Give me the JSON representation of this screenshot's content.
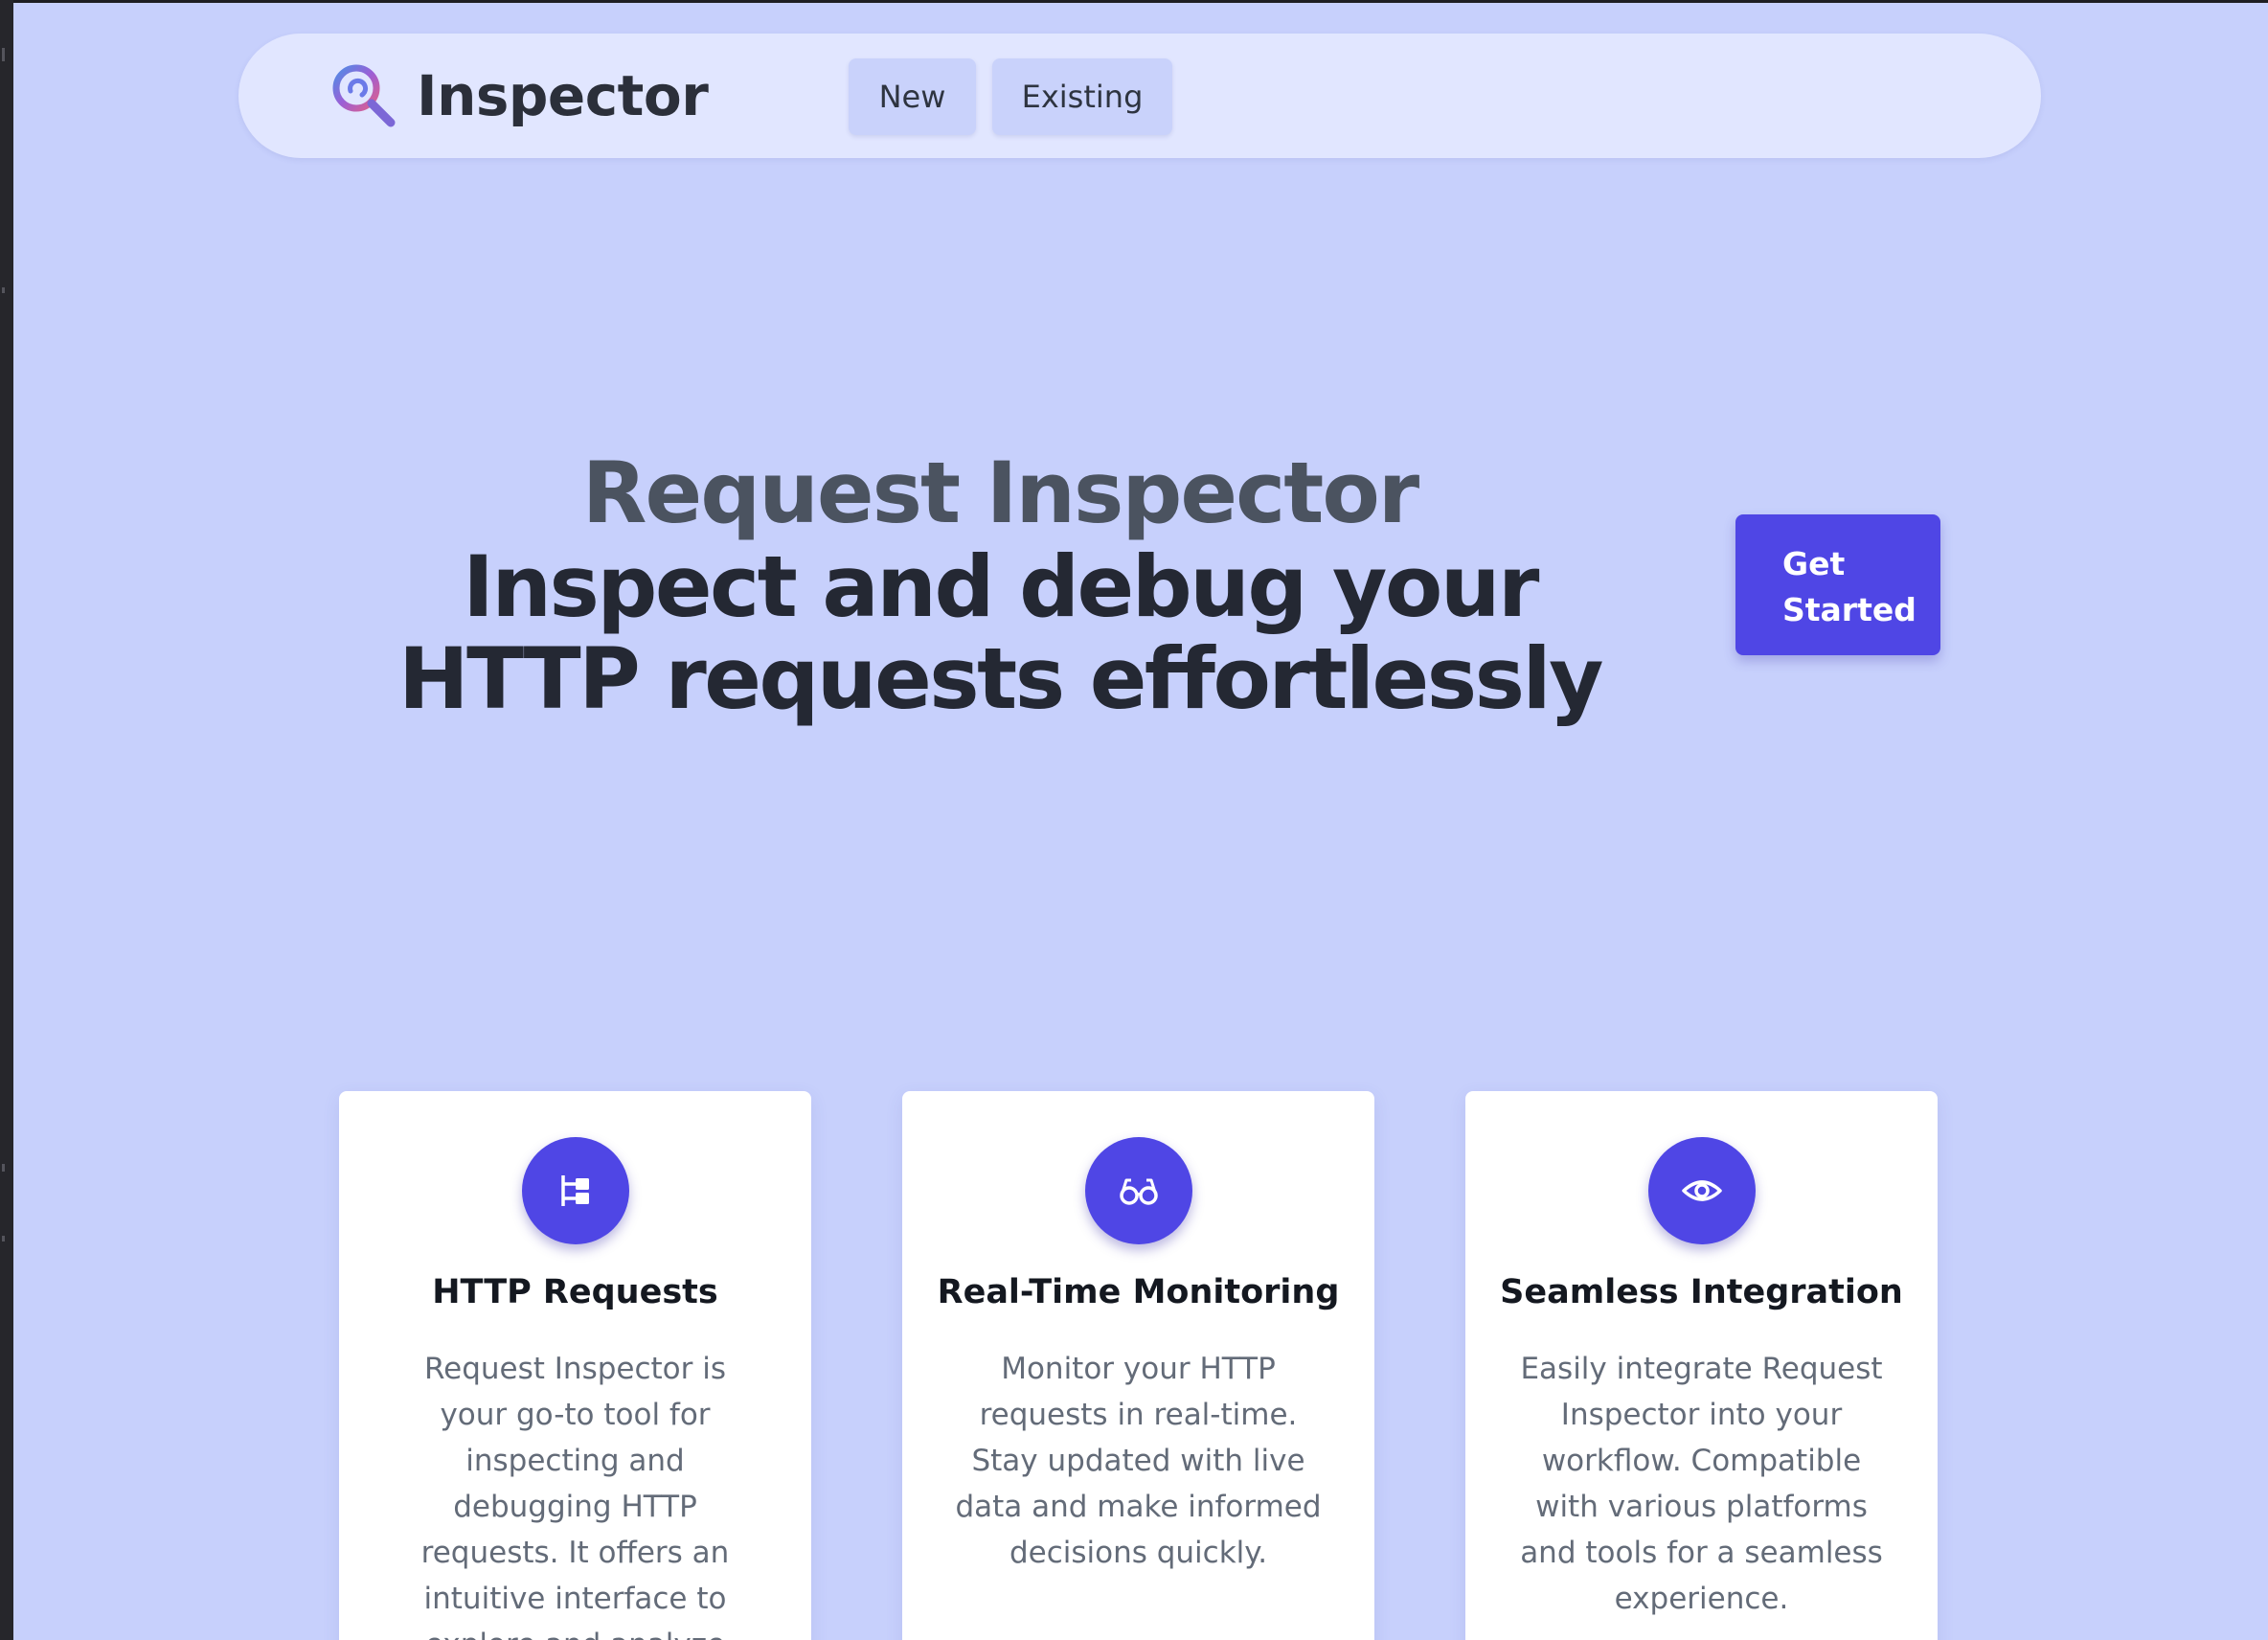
{
  "nav": {
    "brand": "Inspector",
    "logo_icon": "magnifier-logo-icon",
    "links": [
      "New",
      "Existing"
    ]
  },
  "hero": {
    "title": "Request Inspector",
    "subtitle": "Inspect and debug your HTTP requests effortlessly",
    "cta": "Get Started"
  },
  "features": [
    {
      "icon": "hierarchy-icon",
      "title": "HTTP Requests",
      "text": "Request Inspector is your go-to tool for inspecting and debugging HTTP requests. It offers an intuitive interface to explore and analyze"
    },
    {
      "icon": "glasses-icon",
      "title": "Real-Time Monitoring",
      "text": "Monitor your HTTP requests in real-time. Stay updated with live data and make informed decisions quickly."
    },
    {
      "icon": "eye-icon",
      "title": "Seamless Integration",
      "text": "Easily integrate Request Inspector into your workflow. Compatible with various platforms and tools for a seamless experience."
    }
  ],
  "colors": {
    "background": "#c7d0fc",
    "nav_background": "#e1e6ff",
    "accent": "#4f46e5",
    "heading": "#242833",
    "body_text": "#636b78"
  }
}
